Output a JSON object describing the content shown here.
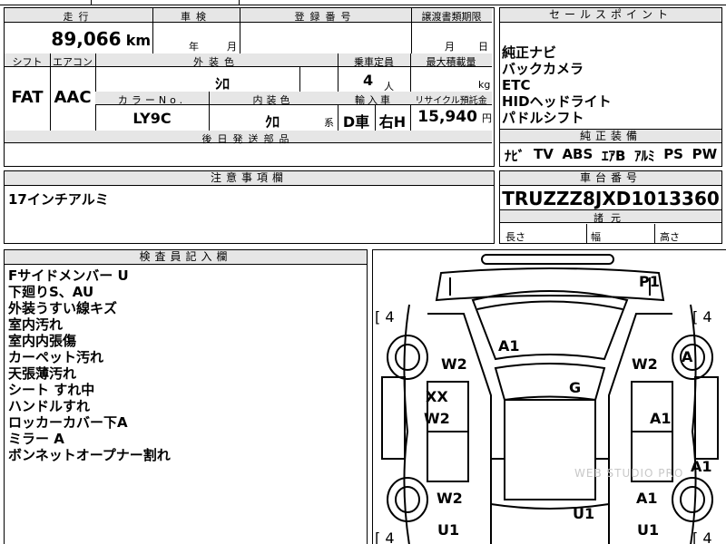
{
  "top_partial": {
    "left_text": "昌",
    "right_text": "刃"
  },
  "mileage": {
    "header": "走行",
    "value": "89,066",
    "unit": "km"
  },
  "inspection": {
    "header": "車検",
    "year_unit": "年",
    "month_unit": "月"
  },
  "registration": {
    "header": "登録番号"
  },
  "transfer_deadline": {
    "header": "譲渡書類期限",
    "month_unit": "月",
    "day_unit": "日"
  },
  "shift": {
    "header": "シフト",
    "value": "FAT"
  },
  "aircon": {
    "header": "エアコン",
    "value": "AAC"
  },
  "exterior_color": {
    "header": "外装色",
    "value": "ｼﾛ"
  },
  "capacity": {
    "header": "乗車定員",
    "value": "4",
    "unit": "人"
  },
  "max_load": {
    "header": "最大積載量",
    "unit": "kg"
  },
  "color_no": {
    "header": "カラーNo.",
    "value": "LY9C"
  },
  "interior_color": {
    "header": "内装色",
    "value": "ｸﾛ",
    "suffix": "系"
  },
  "import": {
    "header": "輸入車",
    "value1": "D車",
    "value2": "右H"
  },
  "recycle": {
    "header": "リサイクル預託金",
    "value": "15,940",
    "unit": "円"
  },
  "later_parts": {
    "header": "後日発送部品"
  },
  "sales_points": {
    "header": "セールスポイント",
    "items": [
      "純正ナビ",
      "バックカメラ",
      "ETC",
      "HIDヘッドライト",
      "パドルシフト"
    ]
  },
  "genuine_equipment": {
    "header": "純正装備",
    "items": [
      "ﾅﾋﾞ",
      "TV",
      "ABS",
      "ｴｱB",
      "ｱﾙﾐ",
      "PS",
      "PW"
    ]
  },
  "notes": {
    "header": "注意事項欄",
    "text": "17インチアルミ"
  },
  "chassis": {
    "header": "車台番号",
    "value": "TRUZZZ8JXD1013360"
  },
  "dimensions": {
    "header": "諸元",
    "length": "長さ",
    "width": "幅",
    "height": "高さ"
  },
  "inspector": {
    "header": "検査員記入欄",
    "items": [
      "Fサイドメンバー U",
      "下廻りS、AU",
      "外装うすい線キズ",
      "室内汚れ",
      "室内内張傷",
      "カーペット汚れ",
      "天張薄汚れ",
      "シート すれ中",
      "ハンドルすれ",
      "ロッカーカバー下A",
      "ミラー A",
      "ボンネットオープナー割れ"
    ]
  },
  "diagram": {
    "tire_left_top": "[ 4",
    "tire_right_top": "[ 4",
    "tire_left_bottom": "[ 4",
    "tire_right_bottom": "[ 4",
    "p1": "P1",
    "a1_roof": "A1",
    "w2_left_front": "W2",
    "w2_right_front": "W2",
    "a_right": "A",
    "xx": "XX",
    "g": "G",
    "w2_left_mid": "W2",
    "a1_right_mid": "A1",
    "a1_far_right": "A1",
    "w2_left_rear": "W2",
    "a1_right_rear": "A1",
    "u1_center": "U1",
    "u1_left": "U1",
    "u1_right": "U1",
    "watermark": "WEB STUDIO PRO"
  }
}
